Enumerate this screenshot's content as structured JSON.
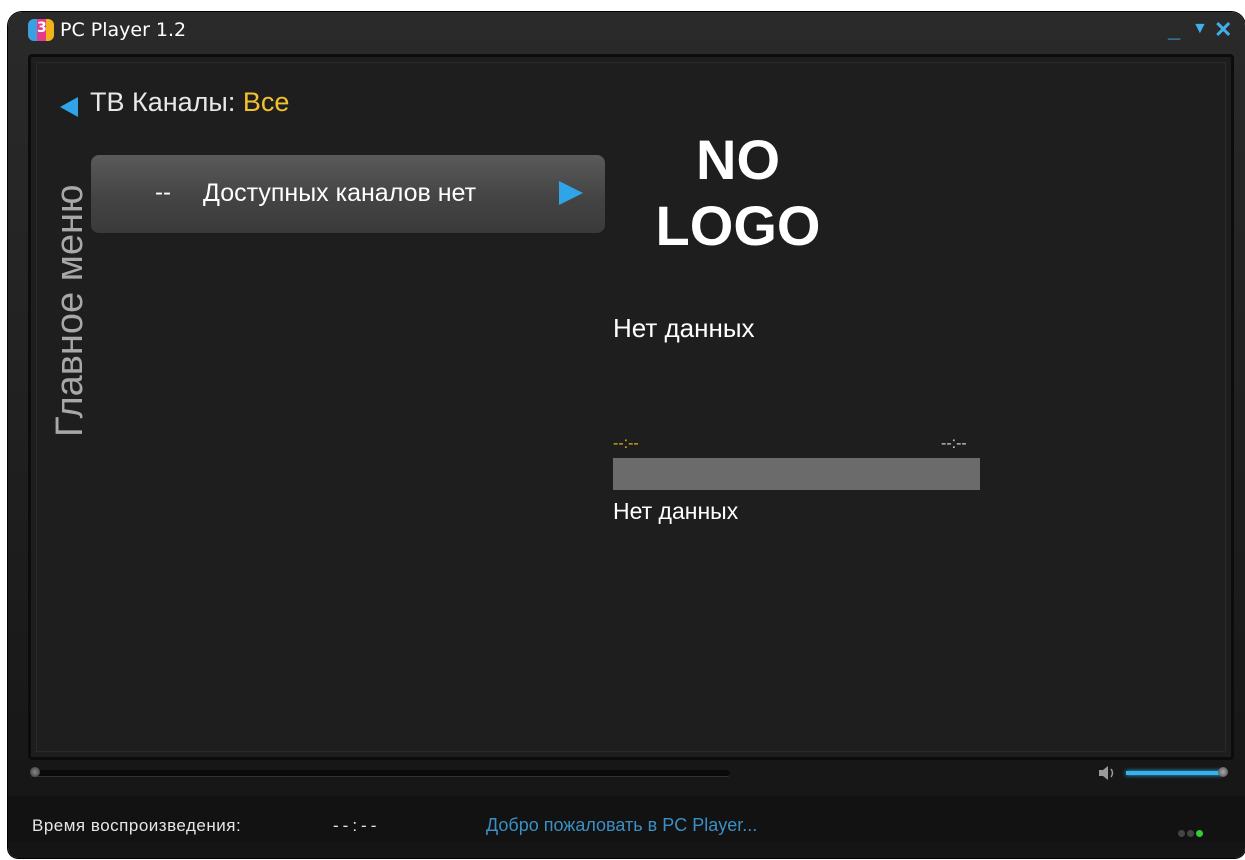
{
  "window": {
    "title": "PC Player 1.2",
    "app_icon_text": "3"
  },
  "header": {
    "channels_label": "ТВ Каналы:",
    "channels_filter": "Все"
  },
  "sidebar": {
    "main_menu": "Главное меню"
  },
  "channel_list": {
    "items": [
      {
        "prefix": "--",
        "label": "Доступных каналов нет"
      }
    ]
  },
  "program": {
    "logo_line1": "NO",
    "logo_line2": "LOGO",
    "title": "Нет данных",
    "start_time": "--:--",
    "end_time": "--:--",
    "progress": 0,
    "description": "Нет данных"
  },
  "player": {
    "seek_progress": 0,
    "volume": 1.0
  },
  "status": {
    "playback_label": "Время воспроизведения:",
    "playback_time": "--:--",
    "welcome": "Добро пожаловать в PC Player..."
  },
  "colors": {
    "accent": "#2fa4e7",
    "filter": "#f2c12e",
    "welcome": "#3b8fc4"
  }
}
